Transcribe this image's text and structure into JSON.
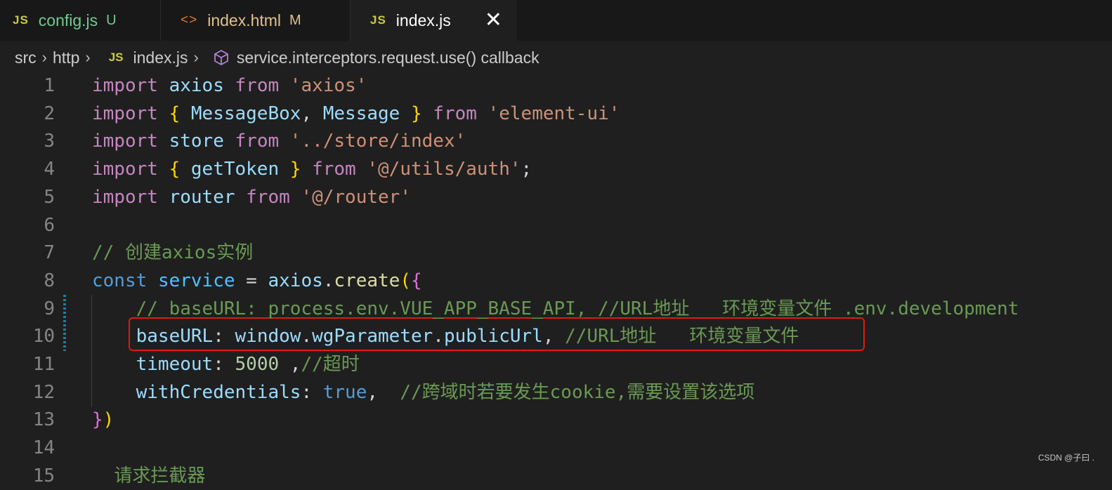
{
  "tabs": [
    {
      "icon": "JS",
      "name": "config.js",
      "status": "U"
    },
    {
      "icon": "<>",
      "name": "index.html",
      "status": "M"
    },
    {
      "icon": "JS",
      "name": "index.js",
      "close": "✕"
    }
  ],
  "breadcrumb": {
    "items": [
      "src",
      "http",
      "index.js",
      "service.interceptors.request.use() callback"
    ],
    "file_icon": "JS",
    "symbol_icon": "cube-icon"
  },
  "editor": {
    "lines": [
      {
        "n": "1",
        "parts": [
          [
            "kw",
            "import"
          ],
          [
            "plain",
            " "
          ],
          [
            "var",
            "axios"
          ],
          [
            "plain",
            " "
          ],
          [
            "kw",
            "from"
          ],
          [
            "plain",
            " "
          ],
          [
            "str",
            "'axios'"
          ]
        ]
      },
      {
        "n": "2",
        "parts": [
          [
            "kw",
            "import"
          ],
          [
            "plain",
            " "
          ],
          [
            "brk1",
            "{"
          ],
          [
            "plain",
            " "
          ],
          [
            "var",
            "MessageBox"
          ],
          [
            "plain",
            ", "
          ],
          [
            "var",
            "Message"
          ],
          [
            "plain",
            " "
          ],
          [
            "brk1",
            "}"
          ],
          [
            "plain",
            " "
          ],
          [
            "kw",
            "from"
          ],
          [
            "plain",
            " "
          ],
          [
            "str",
            "'element-ui'"
          ]
        ]
      },
      {
        "n": "3",
        "parts": [
          [
            "kw",
            "import"
          ],
          [
            "plain",
            " "
          ],
          [
            "var",
            "store"
          ],
          [
            "plain",
            " "
          ],
          [
            "kw",
            "from"
          ],
          [
            "plain",
            " "
          ],
          [
            "str",
            "'../store/index'"
          ]
        ]
      },
      {
        "n": "4",
        "parts": [
          [
            "kw",
            "import"
          ],
          [
            "plain",
            " "
          ],
          [
            "brk1",
            "{"
          ],
          [
            "plain",
            " "
          ],
          [
            "var",
            "getToken"
          ],
          [
            "plain",
            " "
          ],
          [
            "brk1",
            "}"
          ],
          [
            "plain",
            " "
          ],
          [
            "kw",
            "from"
          ],
          [
            "plain",
            " "
          ],
          [
            "str",
            "'@/utils/auth'"
          ],
          [
            "plain",
            ";"
          ]
        ]
      },
      {
        "n": "5",
        "parts": [
          [
            "kw",
            "import"
          ],
          [
            "plain",
            " "
          ],
          [
            "var",
            "router"
          ],
          [
            "plain",
            " "
          ],
          [
            "kw",
            "from"
          ],
          [
            "plain",
            " "
          ],
          [
            "str",
            "'@/router'"
          ]
        ]
      },
      {
        "n": "6",
        "parts": []
      },
      {
        "n": "7",
        "parts": [
          [
            "cmt",
            "// 创建axios实例"
          ]
        ]
      },
      {
        "n": "8",
        "parts": [
          [
            "blue",
            "const"
          ],
          [
            "plain",
            " "
          ],
          [
            "const",
            "service"
          ],
          [
            "plain",
            " = "
          ],
          [
            "var",
            "axios"
          ],
          [
            "plain",
            "."
          ],
          [
            "fn",
            "create"
          ],
          [
            "brk1",
            "("
          ],
          [
            "brk2",
            "{"
          ]
        ]
      },
      {
        "n": "9",
        "parts": [
          [
            "plain",
            "    "
          ],
          [
            "cmt",
            "// baseURL: process.env.VUE_APP_BASE_API, //URL地址   环境变量文件 .env.development"
          ]
        ]
      },
      {
        "n": "10",
        "parts": [
          [
            "plain",
            "    "
          ],
          [
            "var",
            "baseURL"
          ],
          [
            "plain",
            ": "
          ],
          [
            "var",
            "window"
          ],
          [
            "plain",
            "."
          ],
          [
            "var",
            "wgParameter"
          ],
          [
            "plain",
            "."
          ],
          [
            "var",
            "publicUrl"
          ],
          [
            "plain",
            ", "
          ],
          [
            "cmt",
            "//URL地址   环境变量文件"
          ]
        ]
      },
      {
        "n": "11",
        "parts": [
          [
            "plain",
            "    "
          ],
          [
            "var",
            "timeout"
          ],
          [
            "plain",
            ": "
          ],
          [
            "num",
            "5000"
          ],
          [
            "plain",
            " ,"
          ],
          [
            "cmt",
            "//超时"
          ]
        ]
      },
      {
        "n": "12",
        "parts": [
          [
            "plain",
            "    "
          ],
          [
            "var",
            "withCredentials"
          ],
          [
            "plain",
            ": "
          ],
          [
            "blue",
            "true"
          ],
          [
            "plain",
            ",  "
          ],
          [
            "cmt",
            "//跨域时若要发生cookie,需要设置该选项"
          ]
        ]
      },
      {
        "n": "13",
        "parts": [
          [
            "brk2",
            "}"
          ],
          [
            "brk1",
            ")"
          ]
        ]
      },
      {
        "n": "14",
        "parts": []
      },
      {
        "n": "15",
        "parts": [
          [
            "plain",
            "  "
          ],
          [
            "cmt",
            "请求拦截器"
          ]
        ]
      }
    ]
  },
  "watermark": "CSDN @子曰 ."
}
